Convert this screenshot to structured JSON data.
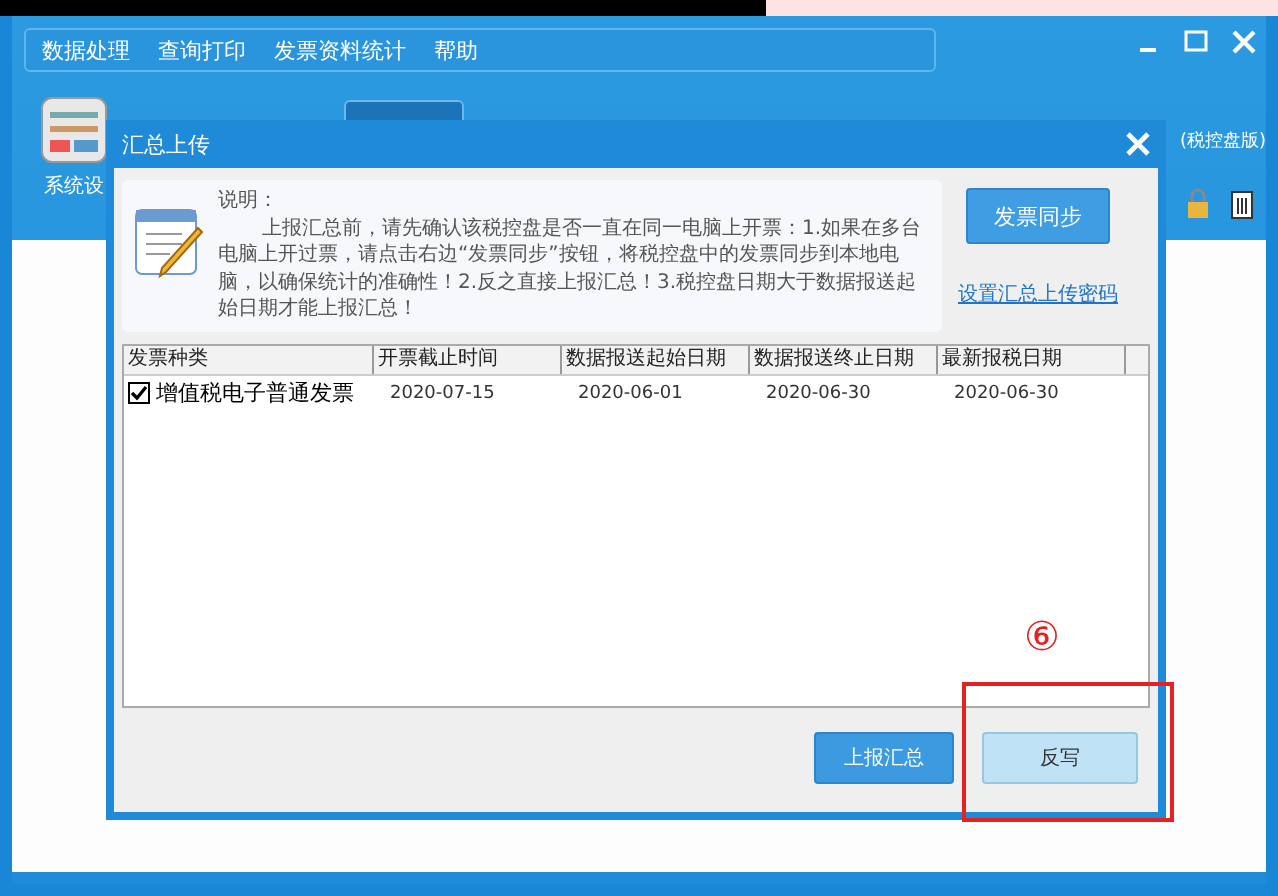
{
  "app": {
    "menu": [
      "数据处理",
      "查询打印",
      "发票资料统计",
      "帮助"
    ],
    "toolbar_label": "系统设",
    "subtitle": "(税控盘版)"
  },
  "dialog": {
    "title": "汇总上传",
    "note_label": "说明：",
    "note_text": "上报汇总前，请先确认该税控盘是否一直在同一电脑上开票：1.如果在多台电脑上开过票，请点击右边“发票同步”按钮，将税控盘中的发票同步到本地电脑，以确保统计的准确性！2.反之直接上报汇总！3.税控盘日期大于数据报送起始日期才能上报汇总！",
    "sync_button": "发票同步",
    "password_link": "设置汇总上传密码",
    "table": {
      "columns": [
        "发票种类",
        "开票截止时间",
        "数据报送起始日期",
        "数据报送终止日期",
        "最新报税日期"
      ],
      "rows": [
        {
          "checked": true,
          "cells": [
            "增值税电子普通发票",
            "2020-07-15",
            "2020-06-01",
            "2020-06-30",
            "2020-06-30"
          ]
        }
      ]
    },
    "buttons": [
      {
        "label": "上报汇总",
        "kind": "primary"
      },
      {
        "label": "反写",
        "kind": "light"
      }
    ]
  },
  "annotation": {
    "label": "⑥"
  }
}
